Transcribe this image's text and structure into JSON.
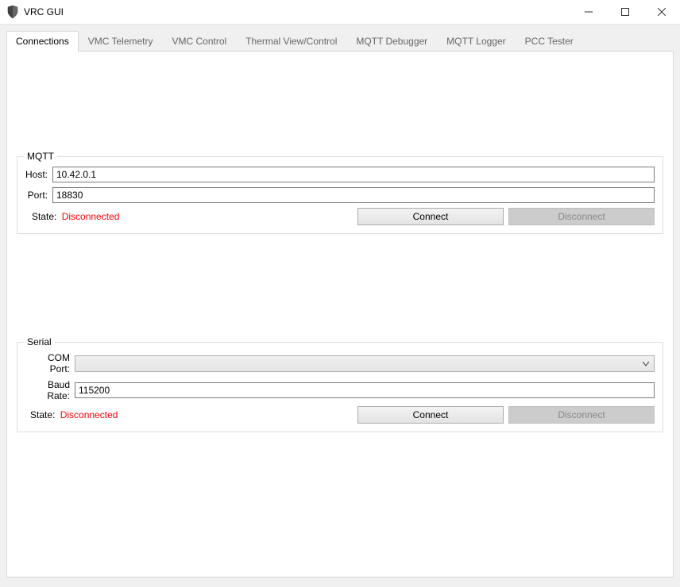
{
  "window": {
    "title": "VRC GUI"
  },
  "tabs": [
    {
      "label": "Connections"
    },
    {
      "label": "VMC Telemetry"
    },
    {
      "label": "VMC Control"
    },
    {
      "label": "Thermal View/Control"
    },
    {
      "label": "MQTT Debugger"
    },
    {
      "label": "MQTT Logger"
    },
    {
      "label": "PCC Tester"
    }
  ],
  "mqtt": {
    "group_title": "MQTT",
    "host_label": "Host:",
    "host_value": "10.42.0.1",
    "port_label": "Port:",
    "port_value": "18830",
    "state_label": "State:",
    "state_value": "Disconnected",
    "connect_label": "Connect",
    "disconnect_label": "Disconnect"
  },
  "serial": {
    "group_title": "Serial",
    "com_label": "COM Port:",
    "com_value": "",
    "baud_label": "Baud Rate:",
    "baud_value": "115200",
    "state_label": "State:",
    "state_value": "Disconnected",
    "connect_label": "Connect",
    "disconnect_label": "Disconnect"
  }
}
